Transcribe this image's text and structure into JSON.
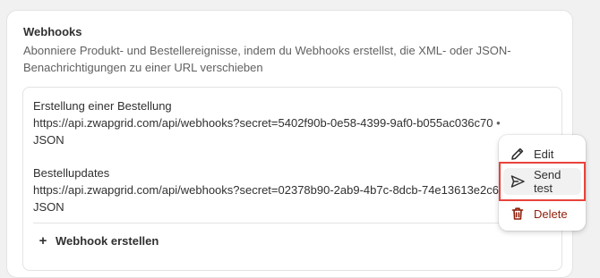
{
  "card": {
    "title": "Webhooks",
    "description": "Abonniere Produkt- und Bestellereignisse, indem du Webhooks erstellst, die XML- oder JSON-Benachrichtigungen zu einer URL verschieben"
  },
  "webhooks": [
    {
      "name": "Erstellung einer Bestellung",
      "url": "https://api.zwapgrid.com/api/webhooks?secret=5402f90b-0e58-4399-9af0-b055ac036c70",
      "separator": "•",
      "format": "JSON"
    },
    {
      "name": "Bestellupdates",
      "url": "https://api.zwapgrid.com/api/webhooks?secret=02378b90-2ab9-4b7c-8dcb-74e13613e2c6",
      "separator": "",
      "format": "JSON"
    }
  ],
  "actions": {
    "create_label": "Webhook erstellen",
    "create_icon": "plus-icon",
    "more_icon": "ellipsis-icon"
  },
  "menu": {
    "items": [
      {
        "label": "Edit",
        "icon": "pencil-icon"
      },
      {
        "label": "Send test",
        "icon": "send-icon"
      },
      {
        "label": "Delete",
        "icon": "trash-icon"
      }
    ]
  },
  "colors": {
    "delete": "#8e1f0b",
    "highlight": "#e8433b",
    "text": "#303030",
    "muted": "#616161"
  }
}
